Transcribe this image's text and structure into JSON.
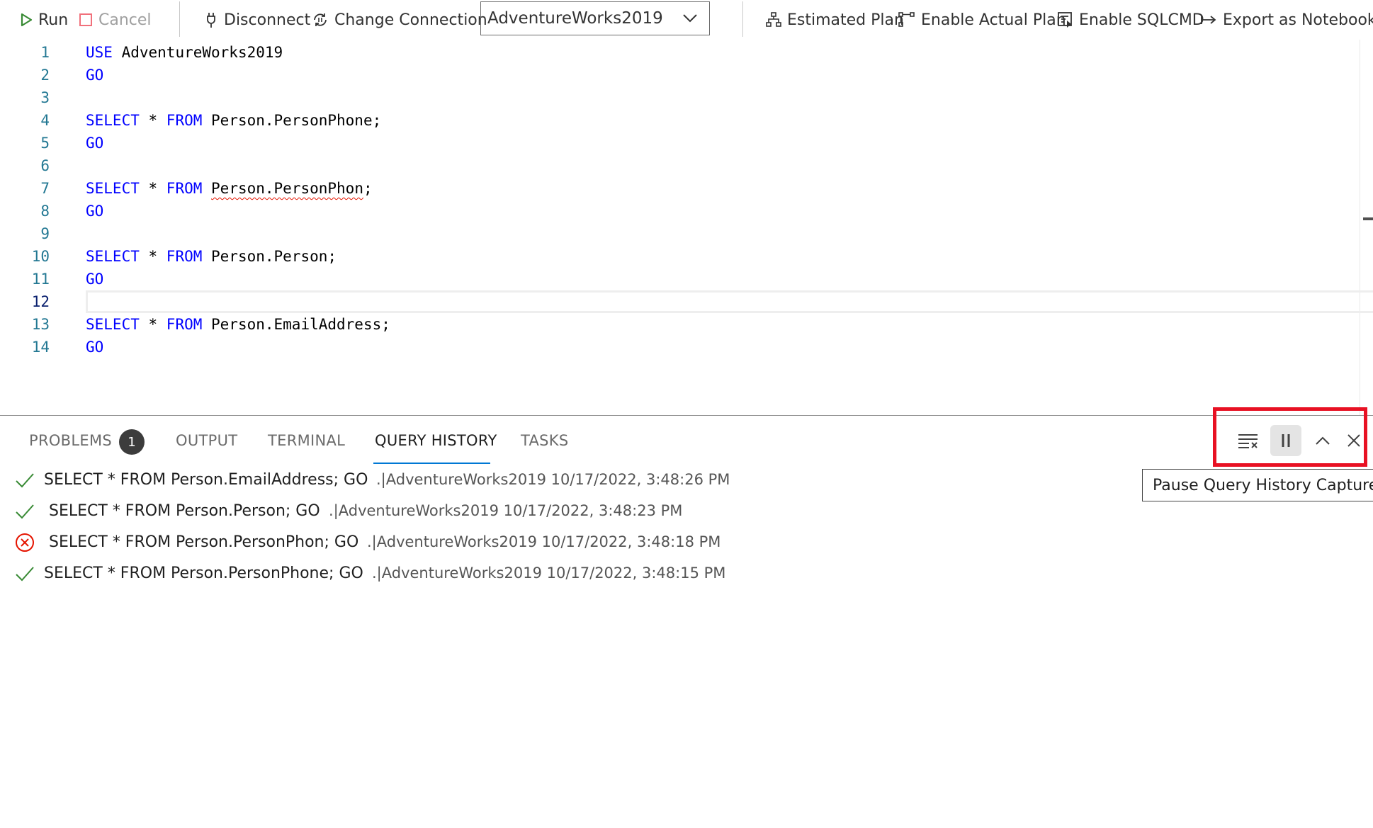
{
  "toolbar": {
    "run_label": "Run",
    "cancel_label": "Cancel",
    "disconnect_label": "Disconnect",
    "change_connection_label": "Change Connection",
    "database_selected": "AdventureWorks2019",
    "estimated_plan_label": "Estimated Plan",
    "enable_actual_plan_label": "Enable Actual Plan",
    "enable_sqlcmd_label": "Enable SQLCMD",
    "export_notebook_label": "Export as Notebook"
  },
  "editor": {
    "current_line": 12,
    "lines": [
      {
        "num": "1",
        "kw": "USE",
        "rest": " AdventureWorks2019"
      },
      {
        "num": "2",
        "kw": "GO",
        "rest": ""
      },
      {
        "num": "3",
        "kw": "",
        "rest": ""
      },
      {
        "num": "4",
        "kw": "SELECT",
        "mid": " * ",
        "kw2": "FROM",
        "rest": " Person.PersonPhone;"
      },
      {
        "num": "5",
        "kw": "GO",
        "rest": ""
      },
      {
        "num": "6",
        "kw": "",
        "rest": ""
      },
      {
        "num": "7",
        "kw": "SELECT",
        "mid": " * ",
        "kw2": "FROM",
        "err": "Person.PersonPhon",
        "rest": ";"
      },
      {
        "num": "8",
        "kw": "GO",
        "rest": ""
      },
      {
        "num": "9",
        "kw": "",
        "rest": ""
      },
      {
        "num": "10",
        "kw": "SELECT",
        "mid": " * ",
        "kw2": "FROM",
        "rest": " Person.Person;"
      },
      {
        "num": "11",
        "kw": "GO",
        "rest": ""
      },
      {
        "num": "12",
        "kw": "",
        "rest": ""
      },
      {
        "num": "13",
        "kw": "SELECT",
        "mid": " * ",
        "kw2": "FROM",
        "rest": " Person.EmailAddress;"
      },
      {
        "num": "14",
        "kw": "GO",
        "rest": ""
      }
    ]
  },
  "panel": {
    "tabs": [
      "PROBLEMS",
      "OUTPUT",
      "TERMINAL",
      "QUERY HISTORY",
      "TASKS"
    ],
    "active_tab": "QUERY HISTORY",
    "problems_count": "1",
    "tooltip": "Pause Query History Capture",
    "actions": [
      "clear-history-icon",
      "pause-icon",
      "chevron-up-icon",
      "close-icon"
    ]
  },
  "history": [
    {
      "status": "success",
      "query": "SELECT * FROM Person.EmailAddress; GO",
      "meta": ".|AdventureWorks2019 10/17/2022, 3:48:26 PM"
    },
    {
      "status": "success",
      "query": "SELECT * FROM Person.Person; GO",
      "meta": ".|AdventureWorks2019 10/17/2022, 3:48:23 PM"
    },
    {
      "status": "error",
      "query": "SELECT * FROM Person.PersonPhon; GO",
      "meta": ".|AdventureWorks2019 10/17/2022, 3:48:18 PM"
    },
    {
      "status": "success",
      "query": "SELECT * FROM Person.PersonPhone; GO",
      "meta": ".|AdventureWorks2019 10/17/2022, 3:48:15 PM"
    }
  ],
  "colors": {
    "keyword": "#0000ff",
    "line_number": "#237893",
    "success": "#388a34",
    "error": "#e51400",
    "highlight": "#e81123",
    "active_tab_underline": "#0078d4"
  }
}
